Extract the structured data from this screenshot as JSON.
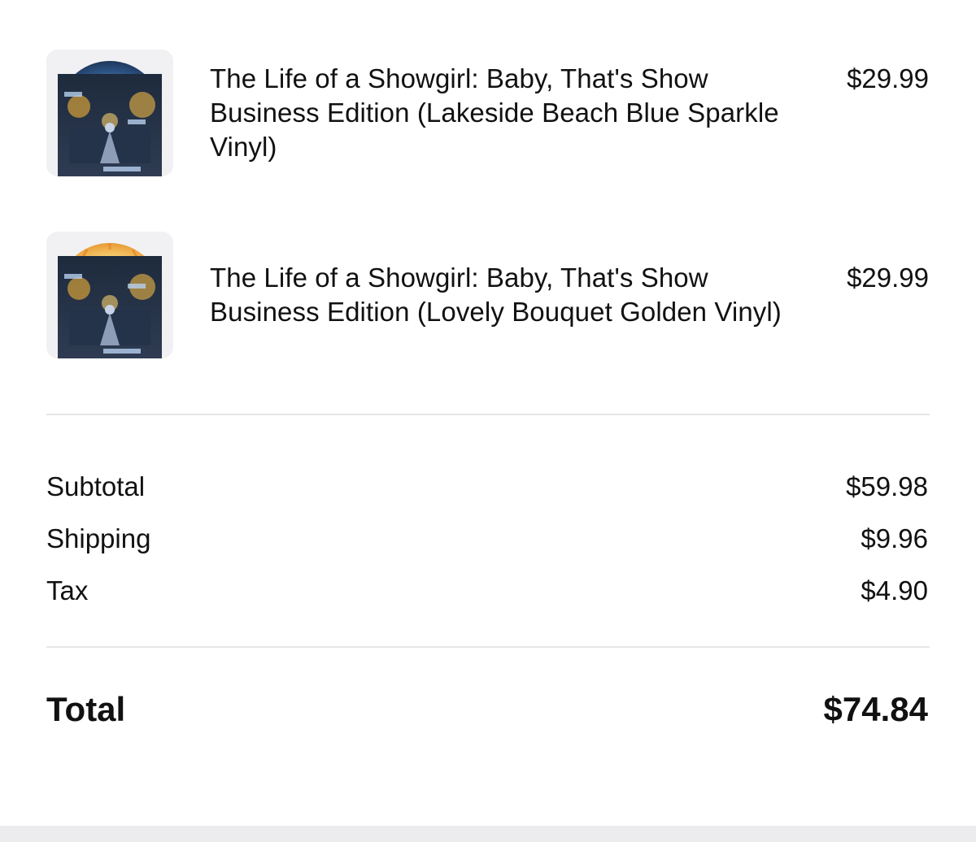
{
  "items": [
    {
      "title_line1": "The Life of a Showgirl: Baby, That's Show",
      "title_line2": "Business Edition (Lakeside Beach Blue Sparkle",
      "title_line3": "Vinyl)",
      "price": "$29.99",
      "image_icon": "album-cover-blue-vinyl",
      "accent_color": "#2f5f9e"
    },
    {
      "title_line1": "The Life of a Showgirl: Baby, That's Show",
      "title_line2": "Business Edition (Lovely Bouquet Golden Vinyl)",
      "title_line3": "",
      "price": "$29.99",
      "image_icon": "album-cover-golden-vinyl",
      "accent_color": "#f0b64a"
    }
  ],
  "summary": {
    "subtotal_label": "Subtotal",
    "subtotal_value": "$59.98",
    "shipping_label": "Shipping",
    "shipping_value": "$9.96",
    "tax_label": "Tax",
    "tax_value": "$4.90"
  },
  "total": {
    "label": "Total",
    "value": "$74.84"
  }
}
